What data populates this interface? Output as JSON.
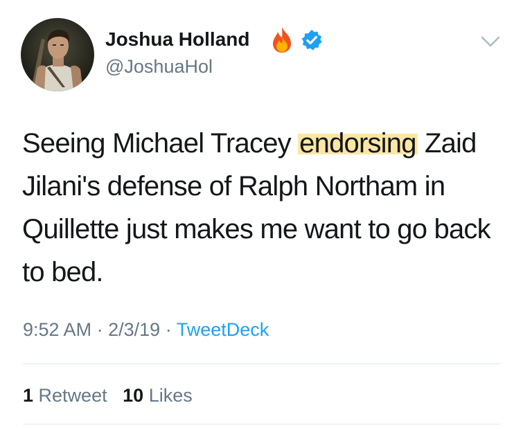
{
  "tweet": {
    "display_name": "Joshua Holland",
    "handle": "@JoshuaHol",
    "name_emoji_icon": "fire-icon",
    "verified_icon": "verified-badge-icon",
    "menu_icon": "chevron-down-icon",
    "text_before": "Seeing Michael Tracey ",
    "text_highlight": "endorsing",
    "text_after": " Zaid Jilani's defense of Ralph Northam in Quillette just makes me want to go back to bed.",
    "time": "9:52 AM",
    "date": "2/3/19",
    "source": "TweetDeck",
    "separator": "·",
    "retweets_count": "1",
    "retweets_label": "Retweet",
    "likes_count": "10",
    "likes_label": "Likes"
  },
  "colors": {
    "text": "#14171a",
    "secondary": "#657786",
    "link": "#1da1f2",
    "verified": "#1da1f2",
    "highlight": "#fbe7a3",
    "divider": "#e1e8ed"
  }
}
